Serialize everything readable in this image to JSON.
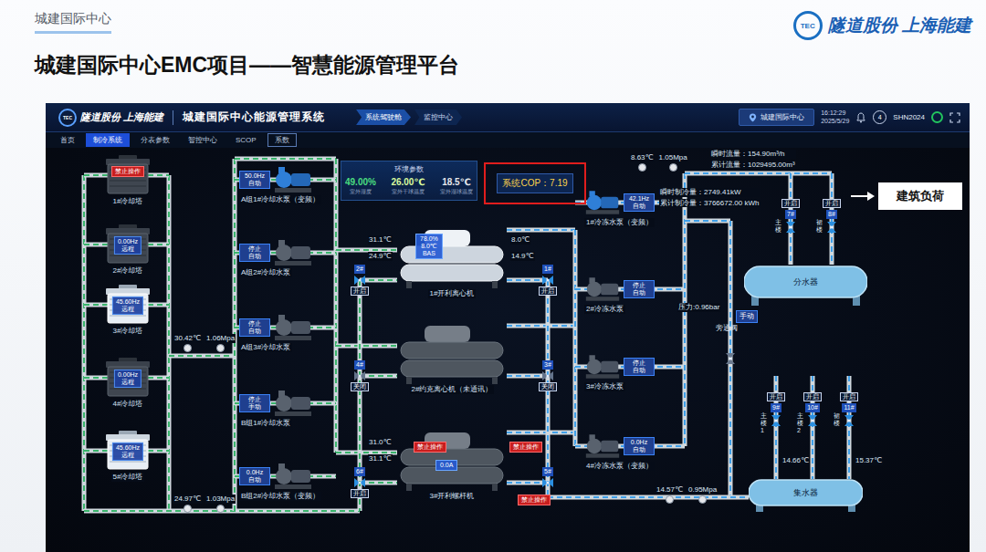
{
  "slide": {
    "section": "城建国际中心",
    "title": "城建国际中心EMC项目——智慧能源管理平台",
    "logo_mark": "TEC",
    "logo_text": "隧道股份 上海能建"
  },
  "app": {
    "logo_mark": "TEC",
    "logo_text": "隧道股份 上海能建",
    "title": "城建国际中心能源管理系统",
    "breadcrumb": [
      {
        "label": "系统驾驶舱",
        "selected": true
      },
      {
        "label": "监控中心",
        "selected": false
      }
    ],
    "site": "城建国际中心",
    "time": "16:12:29",
    "date": "2025/5/29",
    "badge": "4",
    "user": "SHN2024",
    "online": true
  },
  "tabs": [
    {
      "label": "首页",
      "selected": false
    },
    {
      "label": "制冷系统",
      "selected": true
    },
    {
      "label": "分表参数",
      "selected": false
    },
    {
      "label": "智控中心",
      "selected": false
    },
    {
      "label": "SCOP",
      "selected": false
    },
    {
      "label": "系数",
      "selected": false
    }
  ],
  "environment": {
    "title": "环境参数",
    "items": [
      {
        "value": "49.00%",
        "label": "室外湿度"
      },
      {
        "value": "26.00℃",
        "label": "室外干球温度"
      },
      {
        "value": "18.5℃",
        "label": "室外湿球温度"
      }
    ]
  },
  "cop": "系统COP：7.19",
  "cooling_towers": [
    {
      "name": "1#冷却塔",
      "running": false,
      "badge": "禁止操作"
    },
    {
      "name": "2#冷却塔",
      "running": false,
      "freq": "0.00Hz",
      "mode": "远程"
    },
    {
      "name": "3#冷却塔",
      "running": true,
      "freq": "45.60Hz",
      "mode": "远程"
    },
    {
      "name": "4#冷却塔",
      "running": false,
      "freq": "0.00Hz",
      "mode": "远程"
    },
    {
      "name": "5#冷却塔",
      "running": true,
      "freq": "45.60Hz",
      "mode": "远程"
    }
  ],
  "cooling_pumps": [
    {
      "name": "A组1#冷却水泵（变频）",
      "status": "50.0Hz",
      "mode": "自动",
      "running": true
    },
    {
      "name": "A组2#冷却水泵",
      "status": "停止",
      "mode": "自动",
      "running": false
    },
    {
      "name": "A组3#冷却水泵",
      "status": "停止",
      "mode": "自动",
      "running": false
    },
    {
      "name": "B组1#冷却水泵",
      "status": "停止",
      "mode": "手动",
      "running": false
    },
    {
      "name": "B组2#冷却水泵（变频）",
      "status": "0.0Hz",
      "mode": "自动",
      "running": false
    }
  ],
  "chilled_pumps": [
    {
      "name": "1#冷冻水泵（变频）",
      "status": "42.1Hz",
      "mode": "自动",
      "running": true
    },
    {
      "name": "2#冷冻水泵",
      "status": "停止",
      "mode": "自动",
      "running": false
    },
    {
      "name": "3#冷冻水泵",
      "status": "停止",
      "mode": "自动",
      "running": false
    },
    {
      "name": "4#冷冻水泵（变频）",
      "status": "0.0Hz",
      "mode": "自动",
      "running": false
    }
  ],
  "chillers": [
    {
      "name": "1#开利离心机",
      "running": true,
      "readout": [
        "78.0%",
        "8.0℃",
        "BAS"
      ],
      "temps": [
        "31.1℃",
        "24.9℃",
        "8.0℃",
        "14.9℃"
      ],
      "badges": [],
      "valves": [
        {
          "tag": "2#",
          "label": "开启",
          "open": true
        },
        {
          "tag": "1#",
          "label": "开启",
          "open": true
        }
      ]
    },
    {
      "name": "2#约克离心机（未通讯）",
      "running": false,
      "readout": [],
      "temps": [],
      "badges": [],
      "valves": [
        {
          "tag": "4#",
          "label": "关闭",
          "open": false
        },
        {
          "tag": "3#",
          "label": "关闭",
          "open": false
        }
      ]
    },
    {
      "name": "3#开利螺杆机",
      "running": false,
      "readout": [
        "0.0A"
      ],
      "temps": [
        "31.0℃",
        "31.1℃"
      ],
      "badges": [
        "禁止操作",
        "禁止操作",
        "禁止操作"
      ],
      "valves": [
        {
          "tag": "6#",
          "label": "开启",
          "open": true
        },
        {
          "tag": "5#",
          "open": true
        }
      ]
    }
  ],
  "readings": [
    {
      "temp": "30.42℃",
      "pressure": "1.06Mpa"
    },
    {
      "temp": "24.97℃",
      "pressure": "1.03Mpa"
    },
    {
      "temp": "8.63℃",
      "pressure": "1.05Mpa"
    },
    {
      "temp": "14.57℃",
      "pressure": "0.95Mpa"
    }
  ],
  "flow": {
    "instant": "瞬时流量：154.90m³/h",
    "total": "累计流量：1029495.00m³"
  },
  "cooling": {
    "instant": "瞬时制冷量：2749.41kW",
    "total": "累计制冷量：3766672.00 kWh"
  },
  "bypass": {
    "pressure": "压力:0.96bar",
    "name": "旁通阀",
    "mode": "手动"
  },
  "supply_header": {
    "name": "分水器",
    "valves": [
      {
        "tag": "7#",
        "label": "开启",
        "open": true,
        "branch": "主楼"
      },
      {
        "tag": "8#",
        "label": "开启",
        "open": true,
        "branch": "裙楼"
      }
    ]
  },
  "return_header": {
    "name": "集水器",
    "valves": [
      {
        "tag": "9#",
        "label": "开启",
        "open": true,
        "branch": "主楼1"
      },
      {
        "tag": "10#",
        "label": "开启",
        "open": true,
        "branch": "主楼2"
      },
      {
        "tag": "11#",
        "label": "开启",
        "open": true,
        "branch": "裙楼"
      }
    ],
    "temps": [
      "14.66℃",
      "15.37℃"
    ]
  },
  "load": {
    "label": "建筑负荷"
  }
}
